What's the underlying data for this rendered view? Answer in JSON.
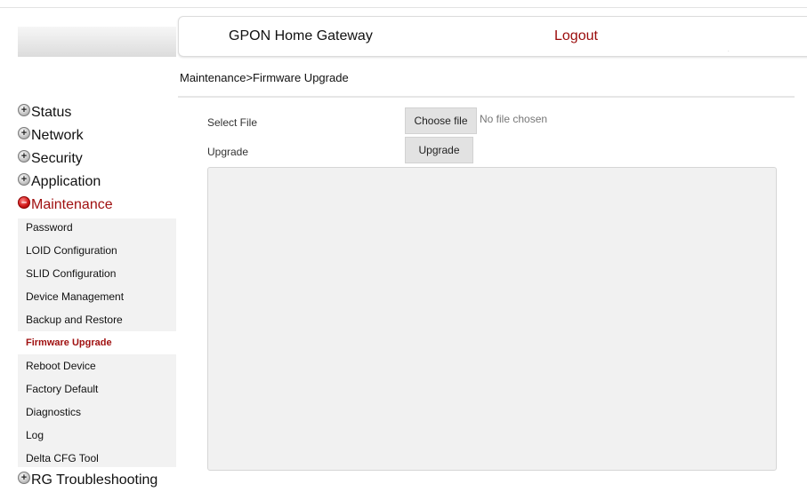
{
  "header": {
    "title": "GPON Home Gateway",
    "logout_label": "Logout",
    "corner_mark": "."
  },
  "breadcrumb": "Maintenance>Firmware Upgrade",
  "sidebar": {
    "sections": [
      {
        "label": "Status",
        "expanded": false
      },
      {
        "label": "Network",
        "expanded": false
      },
      {
        "label": "Security",
        "expanded": false
      },
      {
        "label": "Application",
        "expanded": false
      },
      {
        "label": "Maintenance",
        "expanded": true
      },
      {
        "label": "RG Troubleshooting",
        "expanded": false
      }
    ],
    "maintenance_items": [
      "Password",
      "LOID Configuration",
      "SLID Configuration",
      "Device Management",
      "Backup and Restore",
      "Firmware Upgrade",
      "Reboot Device",
      "Factory Default",
      "Diagnostics",
      "Log",
      "Delta CFG Tool"
    ],
    "active_item": "Firmware Upgrade"
  },
  "form": {
    "select_file_label": "Select File",
    "choose_file_button": "Choose file",
    "file_status": "No file chosen",
    "upgrade_label": "Upgrade",
    "upgrade_button": "Upgrade"
  },
  "icons": {
    "collapsed": "plus-circle-icon",
    "expanded": "minus-circle-icon"
  },
  "colors": {
    "accent_red": "#a01111",
    "button_gray": "#e2e2e2",
    "panel_gray": "#f1f1f1"
  }
}
